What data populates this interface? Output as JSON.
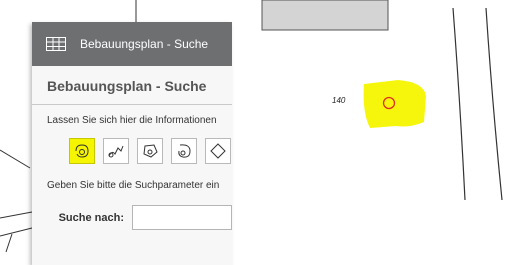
{
  "map": {
    "parcel_number": "140"
  },
  "panel": {
    "title": "Bebauungsplan - Suche",
    "heading": "Bebauungsplan - Suche",
    "info_text": "Lassen Sie sich hier die Informationen",
    "param_text": "Geben Sie bitte die Suchparameter ein",
    "search_label": "Suche nach:",
    "search_value": ""
  },
  "tools": [
    {
      "icon": "point-selection-icon",
      "active": true
    },
    {
      "icon": "line-selection-icon",
      "active": false
    },
    {
      "icon": "polygon-selection-icon",
      "active": false
    },
    {
      "icon": "freehand-selection-icon",
      "active": false
    },
    {
      "icon": "circle-selection-icon",
      "active": false
    }
  ],
  "colors": {
    "highlight": "#f5f500",
    "titlebar": "#6d6f70",
    "marker": "#e0301e"
  }
}
